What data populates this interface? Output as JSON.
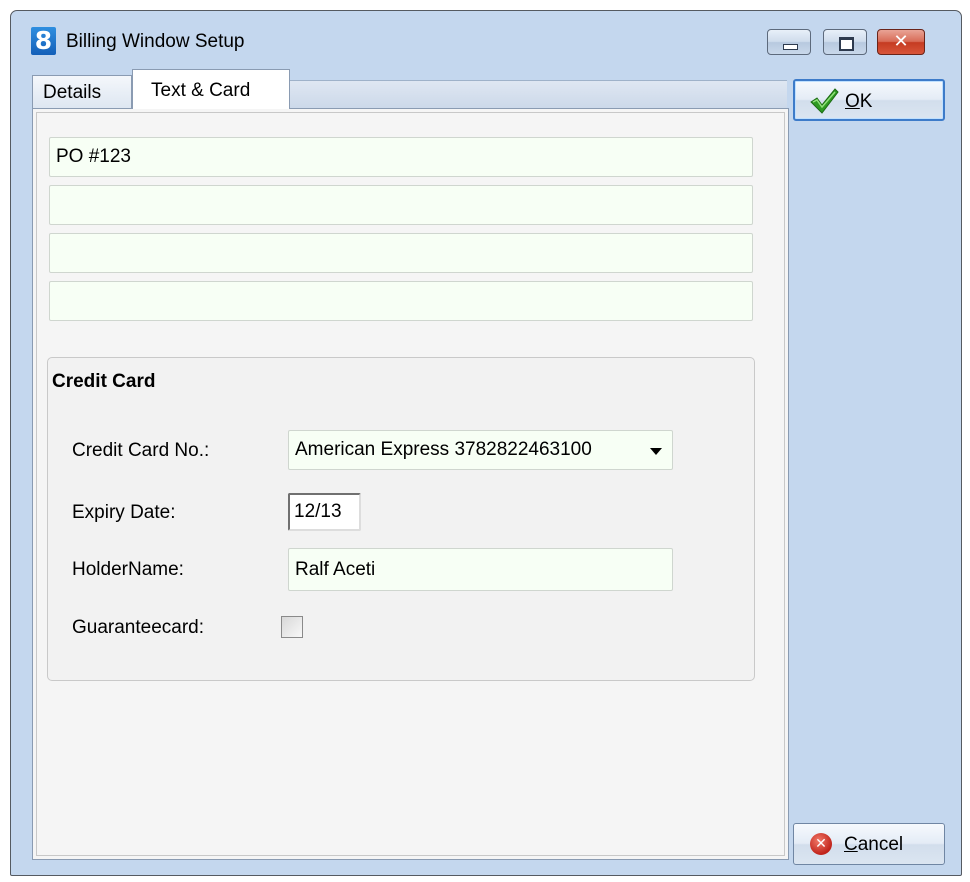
{
  "window": {
    "title": "Billing Window Setup",
    "app_icon_glyph": "8",
    "close_glyph": "✕"
  },
  "tabs": [
    {
      "label": "Details",
      "active": false
    },
    {
      "label": "Text & Card",
      "active": true
    }
  ],
  "text_lines": [
    "PO #123",
    "",
    "",
    ""
  ],
  "credit_card": {
    "title": "Credit Card",
    "card_no_label": "Credit Card No.:",
    "card_no_value": "American Express  3782822463100",
    "expiry_label": "Expiry Date:",
    "expiry_value": "12/13",
    "holder_label": "HolderName:",
    "holder_value": "Ralf Aceti",
    "guarantee_label": "Guaranteecard:",
    "guarantee_checked": false
  },
  "buttons": {
    "ok_mnemonic": "O",
    "ok_rest": "K",
    "cancel_mnemonic": "C",
    "cancel_rest": "ancel"
  },
  "colors": {
    "frame": "#c4d7ee",
    "field_bg": "#f7fff5",
    "close_red": "#c53b22"
  }
}
